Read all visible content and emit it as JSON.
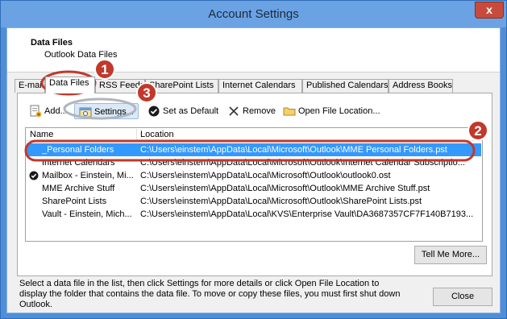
{
  "window": {
    "title": "Account Settings",
    "close_glyph": "x"
  },
  "header": {
    "title": "Data Files",
    "subtitle": "Outlook Data Files"
  },
  "tabs": [
    {
      "label": "E-mail",
      "active": false
    },
    {
      "label": "Data Files",
      "active": true
    },
    {
      "label": "RSS Feeds",
      "active": false
    },
    {
      "label": "SharePoint Lists",
      "active": false
    },
    {
      "label": "Internet Calendars",
      "active": false
    },
    {
      "label": "Published Calendars",
      "active": false
    },
    {
      "label": "Address Books",
      "active": false
    }
  ],
  "toolbar": {
    "add": "Add...",
    "settings": "Settings...",
    "set_default": "Set as Default",
    "remove": "Remove",
    "open_location": "Open File Location..."
  },
  "list": {
    "columns": {
      "name": "Name",
      "location": "Location"
    },
    "rows": [
      {
        "name": "_Personal Folders",
        "location": "C:\\Users\\einstem\\AppData\\Local\\Microsoft\\Outlook\\MME Personal Folders.pst",
        "selected": true,
        "default": false
      },
      {
        "name": "Internet Calendars",
        "location": "C:\\Users\\einstem\\AppData\\Local\\Microsoft\\Outlook\\Internet Calendar Subscriptio...",
        "selected": false,
        "default": false
      },
      {
        "name": "Mailbox - Einstein, Mi...",
        "location": "C:\\Users\\einstem\\AppData\\Local\\Microsoft\\Outlook\\outlook0.ost",
        "selected": false,
        "default": true
      },
      {
        "name": "MME Archive Stuff",
        "location": "C:\\Users\\einstem\\AppData\\Local\\Microsoft\\Outlook\\MME Archive Stuff.pst",
        "selected": false,
        "default": false
      },
      {
        "name": "SharePoint Lists",
        "location": "C:\\Users\\einstem\\AppData\\Local\\Microsoft\\Outlook\\SharePoint Lists.pst",
        "selected": false,
        "default": false
      },
      {
        "name": "Vault - Einstein, Mich...",
        "location": "C:\\Users\\einstem\\AppData\\Local\\KVS\\Enterprise Vault\\DA3687357CF7F140B7193...",
        "selected": false,
        "default": false
      }
    ]
  },
  "help_text": "Select a data file in the list, then click Settings for more details or click Open File Location to display the folder that contains the data file. To move or copy these files, you must first shut down Outlook.",
  "buttons": {
    "tell_me_more": "Tell Me More...",
    "close": "Close"
  },
  "callouts": [
    "1",
    "2",
    "3"
  ],
  "colors": {
    "callout": "#c0392b",
    "selection": "#3399ff",
    "titlebar": "#6aa2e4"
  },
  "icons": {
    "add": "add-file-icon",
    "settings": "settings-icon",
    "set_default": "checkmark-icon",
    "remove": "x-icon",
    "open_location": "folder-icon"
  }
}
